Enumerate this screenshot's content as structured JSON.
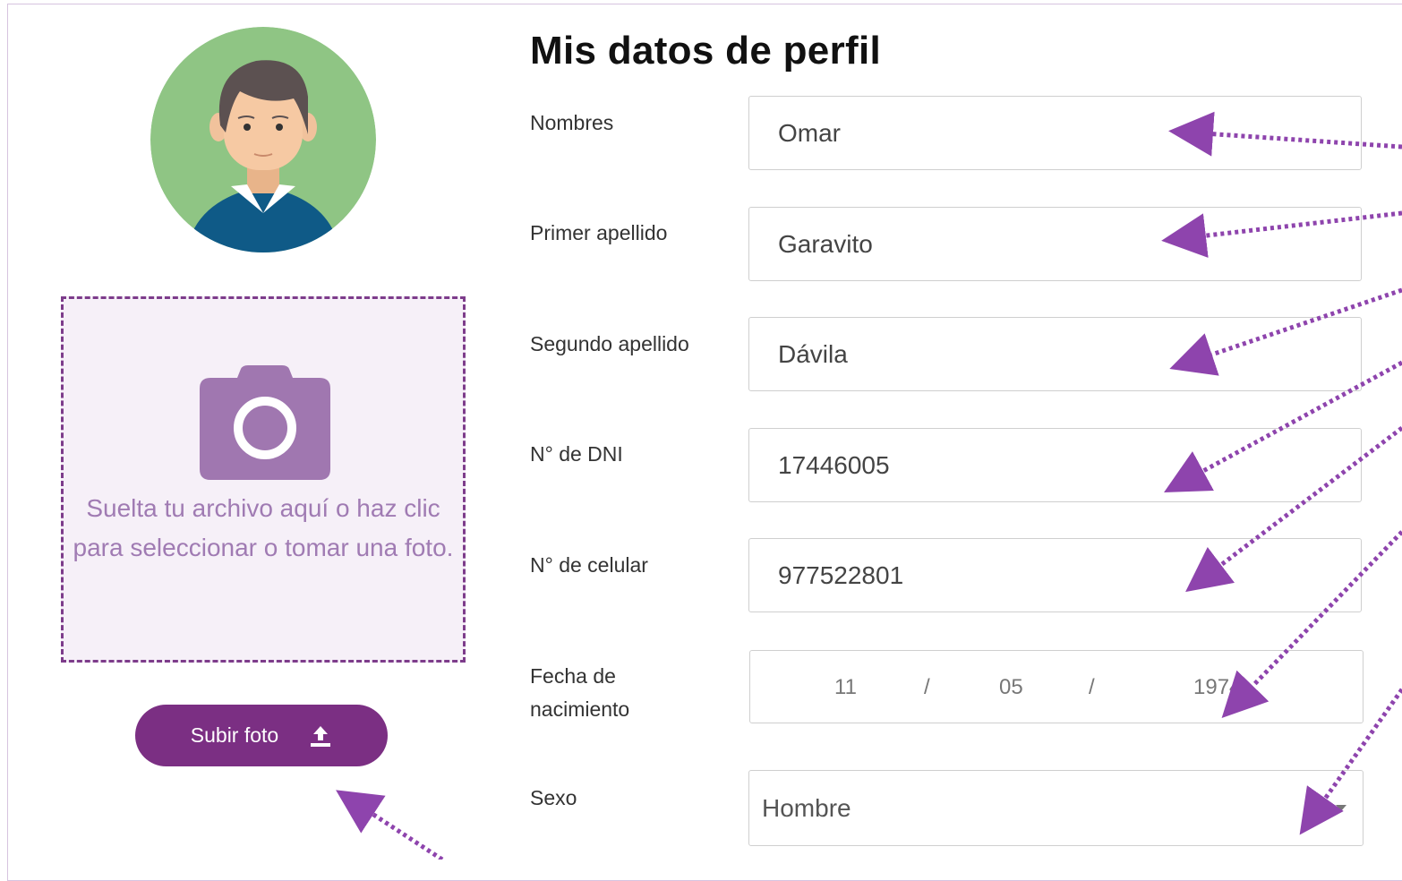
{
  "page": {
    "title": "Mis datos de perfil"
  },
  "photo": {
    "dropzone_text": "Suelta tu archivo aquí o haz clic para seleccionar o tomar una foto.",
    "upload_label": "Subir foto"
  },
  "form": {
    "nombres": {
      "label": "Nombres",
      "value": "Omar"
    },
    "primer_apellido": {
      "label": "Primer apellido",
      "value": "Garavito"
    },
    "segundo_apellido": {
      "label": "Segundo apellido",
      "value": "Dávila"
    },
    "dni": {
      "label": "N° de DNI",
      "value": "17446005"
    },
    "celular": {
      "label": "N° de celular",
      "value": "977522801"
    },
    "fecha": {
      "label_line1": "Fecha de",
      "label_line2": "nacimiento",
      "day": "11",
      "month": "05",
      "year": "1974",
      "separator": "/"
    },
    "sexo": {
      "label": "Sexo",
      "value": "Hombre"
    }
  },
  "colors": {
    "accent": "#7b2f83",
    "dropzone_bg": "#f6f0f8",
    "avatar_bg": "#8fc584",
    "annotation_arrow": "#8e44ad"
  },
  "icons": [
    "user-avatar",
    "camera-icon",
    "upload-icon",
    "chevron-down-icon"
  ]
}
